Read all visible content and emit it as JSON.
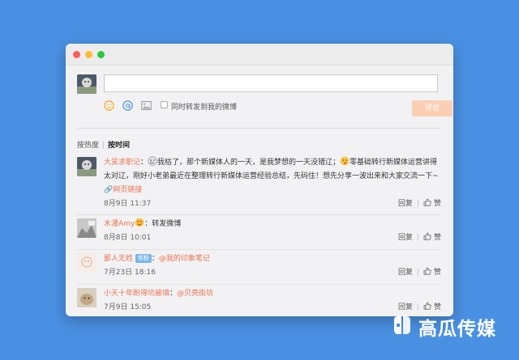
{
  "composer": {
    "input_value": "",
    "sync_label": "同时转发到我的微博",
    "submit_label": "评论",
    "tool_icons": [
      "emoji-icon",
      "at-icon",
      "image-icon"
    ]
  },
  "sort": {
    "tabs": [
      {
        "label": "按热度",
        "active": false
      },
      {
        "label": "按时间",
        "active": true
      }
    ]
  },
  "comments": [
    {
      "author": "大吴求职记",
      "text": "我枯了，那个新媒体人的一天，是我梦想的一天没错辽；",
      "text2": "零基础转行新媒体运营讲得太对辽，刚好小老弟最近在整理转行新媒体运营经验总结，先码住！想先分享一波出来和大家交流一下~",
      "link_label": "网页链接",
      "time": "8月9日 11:37",
      "reply_label": "回复",
      "like_label": "赞"
    },
    {
      "author": "木漫Amy",
      "text": "：转发微博",
      "time": "8月8日 10:01",
      "reply_label": "回复",
      "like_label": "赞"
    },
    {
      "author": "鄙人无姓",
      "badge": "铁粉",
      "mention": "@我的印象笔记",
      "time": "7月23日 18:16",
      "reply_label": "回复",
      "like_label": "赞"
    },
    {
      "author": "小天十年盼得坑被填",
      "mention": "@贝壳街坊",
      "time": "7月9日 15:05",
      "reply_label": "回复",
      "like_label": "赞"
    }
  ],
  "watermark": {
    "text": "高瓜传媒"
  },
  "colors": {
    "background": "#4a90e2",
    "accent": "#eb7350",
    "submit_disabled": "#fbcfb4",
    "badge": "#7ab6e8"
  }
}
